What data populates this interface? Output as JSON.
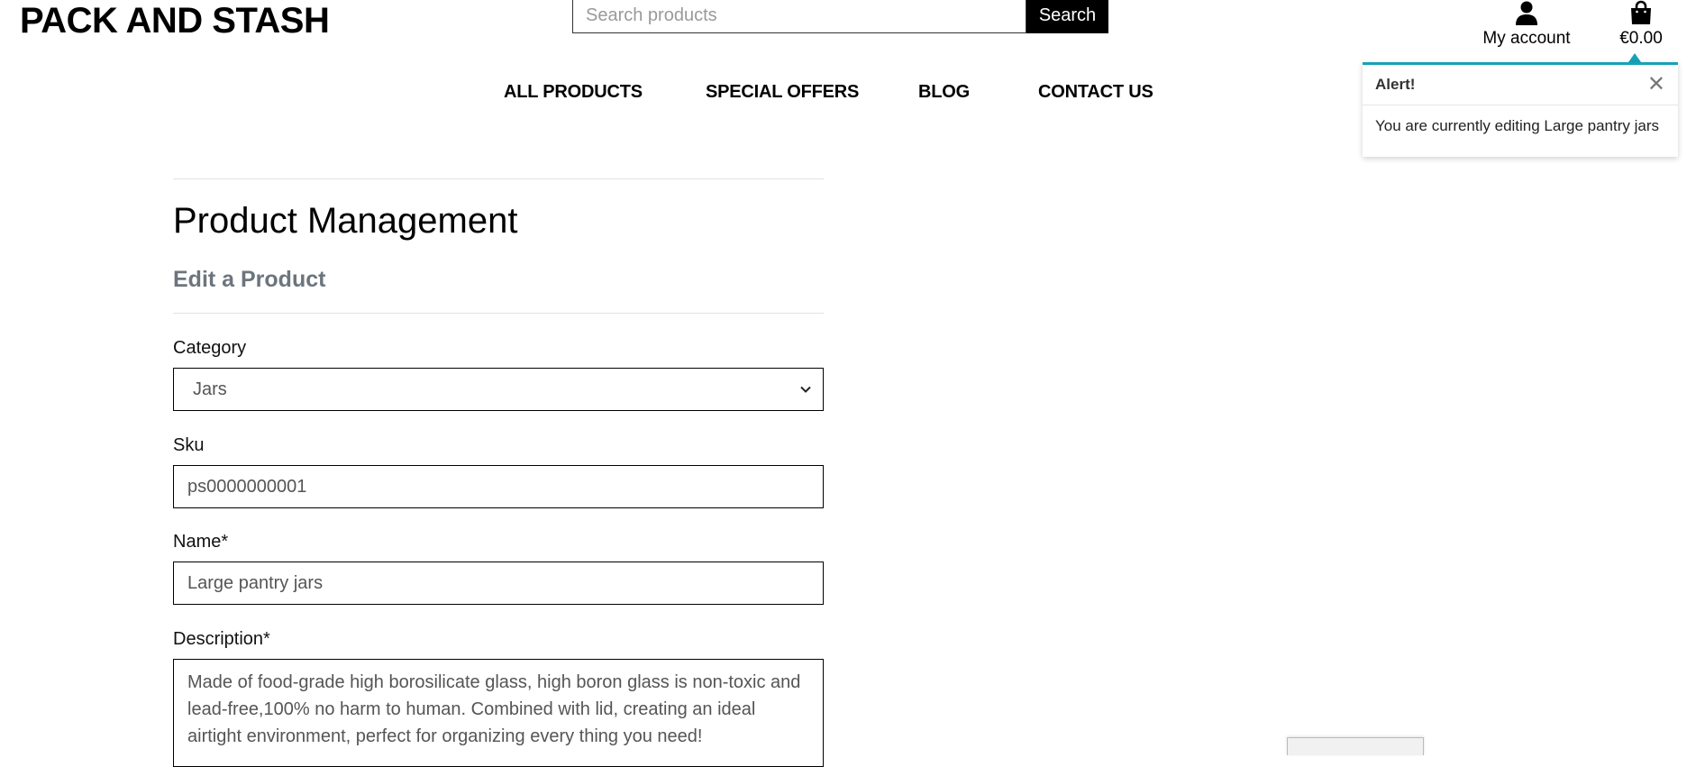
{
  "header": {
    "logo": "PACK AND STASH",
    "search_placeholder": "Search products",
    "search_button": "Search",
    "account_label": "My account",
    "bag_total": "€0.00"
  },
  "nav": {
    "items": [
      "ALL PRODUCTS",
      "SPECIAL OFFERS",
      "BLOG",
      "CONTACT US"
    ]
  },
  "toast": {
    "title": "Alert!",
    "close_glyph": "✕",
    "message": "You are currently editing Large pantry jars",
    "accent_color": "#17a2b8"
  },
  "page": {
    "title": "Product Management",
    "subtitle": "Edit a Product"
  },
  "form": {
    "category": {
      "label": "Category",
      "value": "Jars"
    },
    "sku": {
      "label": "Sku",
      "value": "ps0000000001"
    },
    "name": {
      "label": "Name*",
      "value": "Large pantry jars"
    },
    "description": {
      "label": "Description*",
      "value": "Made of food-grade high borosilicate glass, high boron glass is non-toxic and lead-free,100% no harm to human. Combined with lid, creating an ideal airtight environment, perfect for organizing every thing you need!"
    }
  },
  "icons": {
    "account": "user-icon",
    "bag": "shopping-bag-icon",
    "close": "close-icon",
    "select_chevron": "chevron-down-icon"
  }
}
